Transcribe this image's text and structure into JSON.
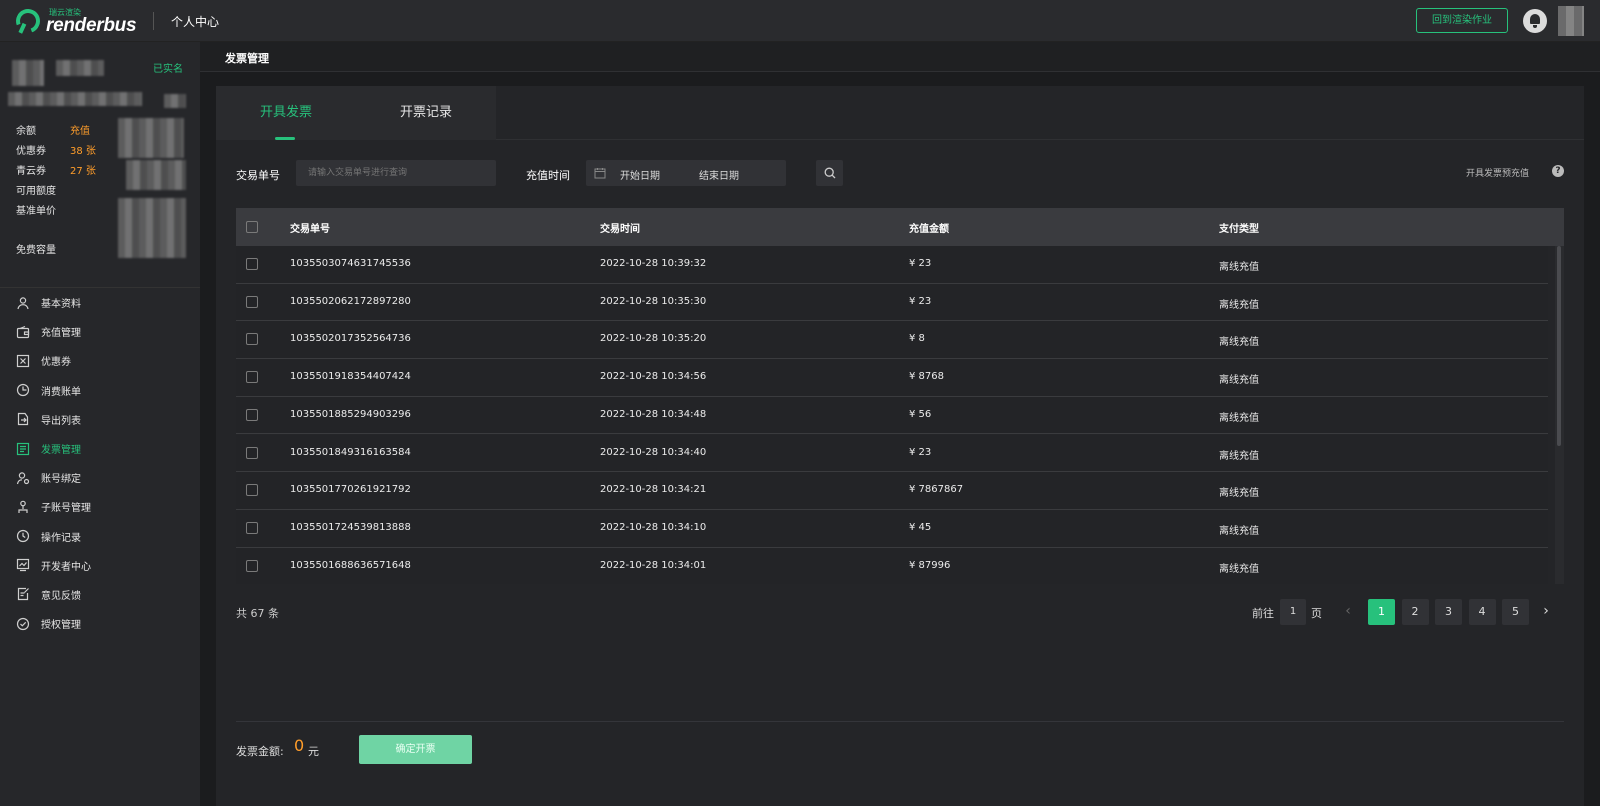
{
  "header": {
    "logo_sub": "瑞云渲染",
    "logo_text": "renderbus",
    "title": "个人中心",
    "back_button": "回到渲染作业",
    "icons": [
      "bell-icon"
    ]
  },
  "sidebar": {
    "verified": "已实名",
    "stats": [
      {
        "label": "余额",
        "value": "充值"
      },
      {
        "label": "优惠券",
        "value": "38 张"
      },
      {
        "label": "青云券",
        "value": "27 张"
      },
      {
        "label": "可用额度",
        "value": ""
      },
      {
        "label": "基准单价",
        "value": ""
      },
      {
        "label": "免费容量",
        "value": ""
      }
    ],
    "menu": [
      {
        "label": "基本资料",
        "icon": "user-icon"
      },
      {
        "label": "充值管理",
        "icon": "wallet-icon"
      },
      {
        "label": "优惠券",
        "icon": "coupon-icon"
      },
      {
        "label": "消费账单",
        "icon": "clock-pie-icon"
      },
      {
        "label": "导出列表",
        "icon": "export-icon"
      },
      {
        "label": "发票管理",
        "icon": "invoice-icon"
      },
      {
        "label": "账号绑定",
        "icon": "link-user-icon"
      },
      {
        "label": "子账号管理",
        "icon": "sub-account-icon"
      },
      {
        "label": "操作记录",
        "icon": "history-icon"
      },
      {
        "label": "开发者中心",
        "icon": "developer-icon"
      },
      {
        "label": "意见反馈",
        "icon": "feedback-icon"
      },
      {
        "label": "授权管理",
        "icon": "check-circle-icon"
      }
    ],
    "active_index": 5
  },
  "breadcrumb": "发票管理",
  "tabs": {
    "active": "开具发票",
    "other": "开票记录"
  },
  "filters": {
    "order_label": "交易单号",
    "order_placeholder": "请输入交易单号进行查询",
    "time_label": "充值时间",
    "date_start": "开始日期",
    "date_end": "结束日期",
    "help": "开具发票预充值"
  },
  "table": {
    "headers": [
      "交易单号",
      "交易时间",
      "充值金额",
      "支付类型"
    ],
    "rows": [
      {
        "id": "1035503074631745536",
        "time": "2022-10-28 10:39:32",
        "amount": "¥ 23",
        "type": "离线充值"
      },
      {
        "id": "1035502062172897280",
        "time": "2022-10-28 10:35:30",
        "amount": "¥ 23",
        "type": "离线充值"
      },
      {
        "id": "1035502017352564736",
        "time": "2022-10-28 10:35:20",
        "amount": "¥ 8",
        "type": "离线充值"
      },
      {
        "id": "1035501918354407424",
        "time": "2022-10-28 10:34:56",
        "amount": "¥ 8768",
        "type": "离线充值"
      },
      {
        "id": "1035501885294903296",
        "time": "2022-10-28 10:34:48",
        "amount": "¥ 56",
        "type": "离线充值"
      },
      {
        "id": "1035501849316163584",
        "time": "2022-10-28 10:34:40",
        "amount": "¥ 23",
        "type": "离线充值"
      },
      {
        "id": "1035501770261921792",
        "time": "2022-10-28 10:34:21",
        "amount": "¥ 7867867",
        "type": "离线充值"
      },
      {
        "id": "1035501724539813888",
        "time": "2022-10-28 10:34:10",
        "amount": "¥ 45",
        "type": "离线充值"
      },
      {
        "id": "1035501688636571648",
        "time": "2022-10-28 10:34:01",
        "amount": "¥ 87996",
        "type": "离线充值"
      }
    ]
  },
  "pagination": {
    "total": "共 67 条",
    "goto_prefix": "前往",
    "goto_value": "1",
    "goto_suffix": "页",
    "pages": [
      "1",
      "2",
      "3",
      "4",
      "5"
    ],
    "active_page": "1",
    "prev": "‹",
    "next": "›"
  },
  "footer": {
    "amount_label": "发票金额:",
    "amount_value": "0",
    "amount_unit": "元",
    "confirm_button": "确定开票"
  },
  "colors": {
    "accent": "#27c17c",
    "warning": "#ff9d2a"
  }
}
